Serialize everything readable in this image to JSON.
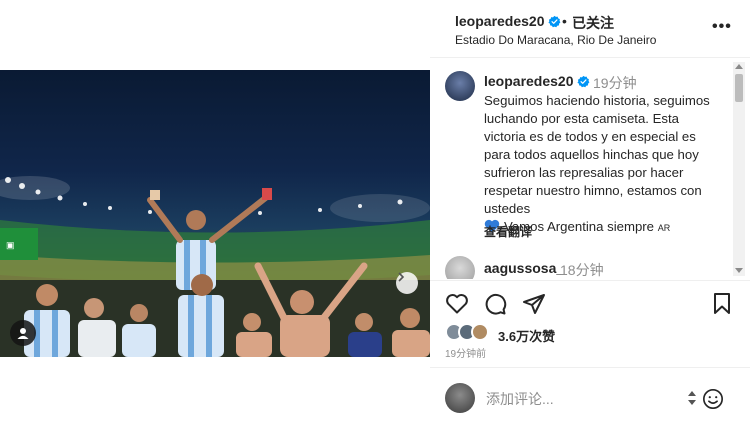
{
  "header": {
    "username": "leoparedes20",
    "separator": "•",
    "follow_status": "已关注",
    "location": "Estadio Do Maracana, Rio De Janeiro",
    "more_icon": "more-horizontal-icon",
    "more_label": "•••"
  },
  "caption": {
    "username": "leoparedes20",
    "time": "19分钟",
    "text": "Seguimos haciendo historia, seguimos luchando por esta camiseta. Esta victoria es de todos y en especial es para todos aquellos hinchas que hoy sufrieron las represalias por hacer respetar nuestro himno, estamos con ustedes",
    "last_line": "Vamos Argentina siempre",
    "flag_text": "AR",
    "see_translation": "查看翻译"
  },
  "comments": [
    {
      "username": "aagussosa_",
      "time": "18分钟"
    }
  ],
  "actions": {
    "like_icon": "heart-icon",
    "comment_icon": "comment-icon",
    "share_icon": "send-icon",
    "save_icon": "bookmark-icon"
  },
  "likes_label": "3.6万次赞",
  "posted_ago": "19分钟前",
  "comment_box": {
    "placeholder": "添加评论...",
    "emoji_icon": "smiley-icon"
  },
  "colors": {
    "verified": "#0095f6",
    "text": "#262626",
    "muted": "#8e8e8e",
    "heart_blue": "#2f7bd8"
  }
}
